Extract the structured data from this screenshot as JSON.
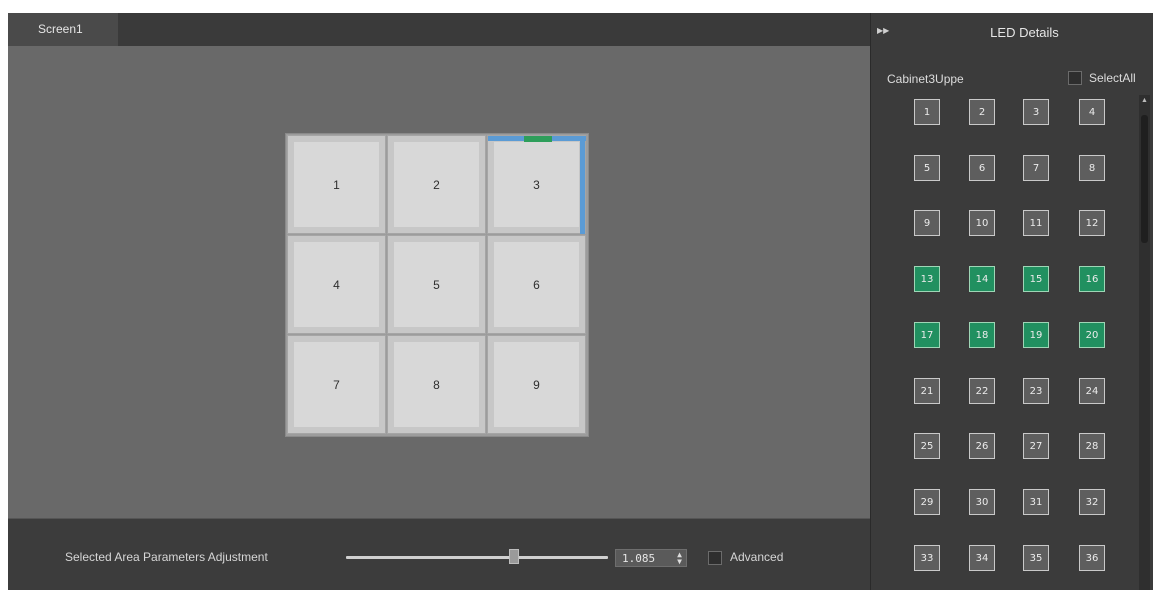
{
  "screen_tab": {
    "label": "Screen1"
  },
  "canvas": {
    "cabinets": [
      {
        "label": "1",
        "selected": false
      },
      {
        "label": "2",
        "selected": false
      },
      {
        "label": "3",
        "selected": true
      },
      {
        "label": "4",
        "selected": false
      },
      {
        "label": "5",
        "selected": false
      },
      {
        "label": "6",
        "selected": false
      },
      {
        "label": "7",
        "selected": false
      },
      {
        "label": "8",
        "selected": false
      },
      {
        "label": "9",
        "selected": false
      }
    ],
    "selection_color": "#5b9bd5",
    "selection_marker_color": "#2e9e5b"
  },
  "adjustment": {
    "label": "Selected Area Parameters Adjustment",
    "slider_level": 0.64,
    "value": "1.085",
    "advanced_label": "Advanced",
    "advanced_checked": false
  },
  "panel": {
    "collapse_icon": "double-chevron-right-icon",
    "title": "LED Details",
    "cabinet_name": "Cabinet3Uppe",
    "select_all_label": "SelectAll",
    "select_all_checked": false,
    "led_buttons": [
      {
        "label": "1",
        "selected": false
      },
      {
        "label": "2",
        "selected": false
      },
      {
        "label": "3",
        "selected": false
      },
      {
        "label": "4",
        "selected": false
      },
      {
        "label": "5",
        "selected": false
      },
      {
        "label": "6",
        "selected": false
      },
      {
        "label": "7",
        "selected": false
      },
      {
        "label": "8",
        "selected": false
      },
      {
        "label": "9",
        "selected": false
      },
      {
        "label": "10",
        "selected": false
      },
      {
        "label": "11",
        "selected": false
      },
      {
        "label": "12",
        "selected": false
      },
      {
        "label": "13",
        "selected": true
      },
      {
        "label": "14",
        "selected": true
      },
      {
        "label": "15",
        "selected": true
      },
      {
        "label": "16",
        "selected": true
      },
      {
        "label": "17",
        "selected": true
      },
      {
        "label": "18",
        "selected": true
      },
      {
        "label": "19",
        "selected": true
      },
      {
        "label": "20",
        "selected": true
      },
      {
        "label": "21",
        "selected": false
      },
      {
        "label": "22",
        "selected": false
      },
      {
        "label": "23",
        "selected": false
      },
      {
        "label": "24",
        "selected": false
      },
      {
        "label": "25",
        "selected": false
      },
      {
        "label": "26",
        "selected": false
      },
      {
        "label": "27",
        "selected": false
      },
      {
        "label": "28",
        "selected": false
      },
      {
        "label": "29",
        "selected": false
      },
      {
        "label": "30",
        "selected": false
      },
      {
        "label": "31",
        "selected": false
      },
      {
        "label": "32",
        "selected": false
      },
      {
        "label": "33",
        "selected": false
      },
      {
        "label": "34",
        "selected": false
      },
      {
        "label": "35",
        "selected": false
      },
      {
        "label": "36",
        "selected": false
      }
    ],
    "selected_color": "#219060",
    "unselected_color": "#5e5e5e"
  }
}
